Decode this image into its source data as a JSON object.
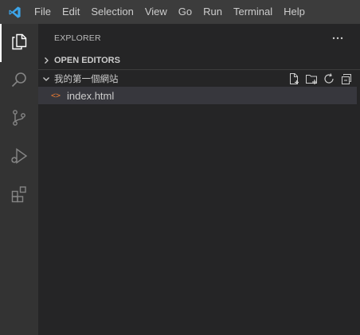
{
  "menu": {
    "items": [
      "File",
      "Edit",
      "Selection",
      "View",
      "Go",
      "Run",
      "Terminal",
      "Help"
    ]
  },
  "activity_bar": {
    "icons": [
      "explorer-icon",
      "search-icon",
      "source-control-icon",
      "run-debug-icon",
      "extensions-icon"
    ],
    "active": "explorer"
  },
  "sidebar": {
    "title": "EXPLORER",
    "more_actions_icon": "ellipsis-icon",
    "sections": [
      {
        "label": "OPEN EDITORS",
        "expanded": false
      },
      {
        "label": "我的第一個網站",
        "expanded": true
      }
    ],
    "folder_actions": [
      "new-file-icon",
      "new-folder-icon",
      "refresh-icon",
      "collapse-all-icon"
    ],
    "files": [
      {
        "name": "index.html",
        "icon_text": "<>",
        "icon": "html-file-icon"
      }
    ]
  },
  "colors": {
    "titlebar": "#3c3c3c",
    "activitybar": "#333333",
    "sidebar": "#252526",
    "selected_row": "#37373d",
    "html_icon": "#e37933",
    "logo": "#3ca5ea"
  }
}
